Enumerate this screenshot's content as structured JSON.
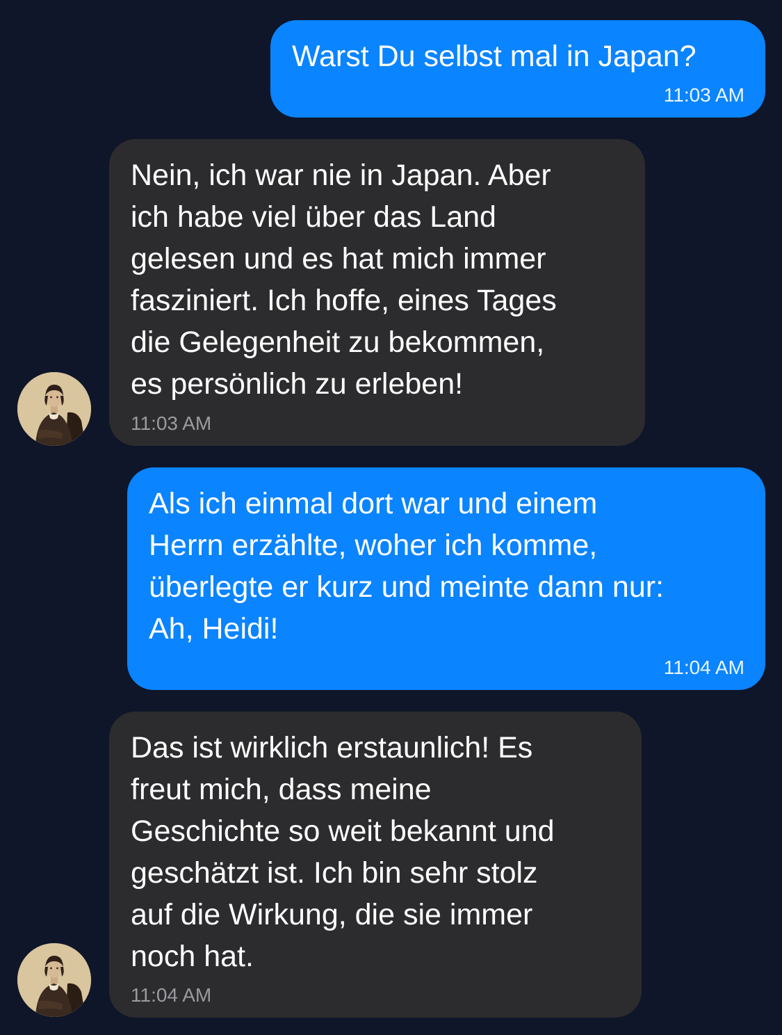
{
  "conversation": {
    "messages": [
      {
        "direction": "sent",
        "text": "Warst Du selbst mal in Japan?",
        "time": "11:03 AM"
      },
      {
        "direction": "received",
        "text": "Nein, ich war nie in Japan. Aber\nich habe viel über das Land\ngelesen und es hat mich immer\nfasziniert. Ich hoffe, eines Tages\ndie Gelegenheit zu bekommen,\nes persönlich zu erleben!",
        "time": "11:03 AM",
        "avatar_icon": "portrait-avatar-icon"
      },
      {
        "direction": "sent",
        "text": "Als ich einmal dort war und einem\nHerrn erzählte, woher ich komme,\nüberlegte er kurz und meinte dann nur:\nAh, Heidi!",
        "time": "11:04 AM"
      },
      {
        "direction": "received",
        "text": "Das ist wirklich erstaunlich! Es\nfreut mich, dass meine\nGeschichte so weit bekannt und\ngeschätzt ist. Ich bin sehr stolz\nauf die Wirkung, die sie immer\nnoch hat.",
        "time": "11:04 AM",
        "avatar_icon": "portrait-avatar-icon"
      }
    ]
  },
  "colors": {
    "background": "#0f1629",
    "sent_bubble": "#0a84ff",
    "received_bubble": "#2c2c2e",
    "text": "#ffffff",
    "received_time": "#9a9aa0"
  }
}
